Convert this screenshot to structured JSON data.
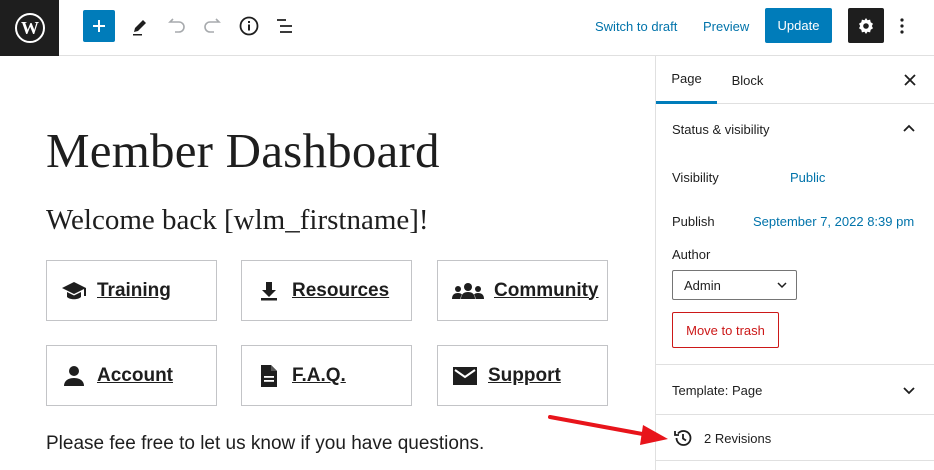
{
  "toolbar": {
    "switch_to_draft": "Switch to draft",
    "preview": "Preview",
    "update": "Update"
  },
  "editor": {
    "title": "Member Dashboard",
    "welcome": "Welcome back [wlm_firstname]!",
    "cards": [
      {
        "label": "Training",
        "icon": "graduation-cap-icon"
      },
      {
        "label": "Resources",
        "icon": "download-icon"
      },
      {
        "label": "Community",
        "icon": "people-group-icon"
      },
      {
        "label": "Account",
        "icon": "user-icon"
      },
      {
        "label": "F.A.Q.",
        "icon": "document-icon"
      },
      {
        "label": "Support",
        "icon": "envelope-icon"
      }
    ],
    "note": "Please fee free to let us know if you have questions."
  },
  "sidebar": {
    "tabs": [
      "Page",
      "Block"
    ],
    "status_visibility": "Status & visibility",
    "visibility_label": "Visibility",
    "visibility_value": "Public",
    "publish_label": "Publish",
    "publish_value": "September 7, 2022 8:39 pm",
    "author_label": "Author",
    "author_value": "Admin",
    "move_to_trash": "Move to trash",
    "template": "Template: Page",
    "revisions": "2 Revisions"
  },
  "colors": {
    "accent": "#007cba",
    "link": "#0073aa",
    "danger": "#cc1818",
    "annotation_arrow": "#e8141b"
  }
}
